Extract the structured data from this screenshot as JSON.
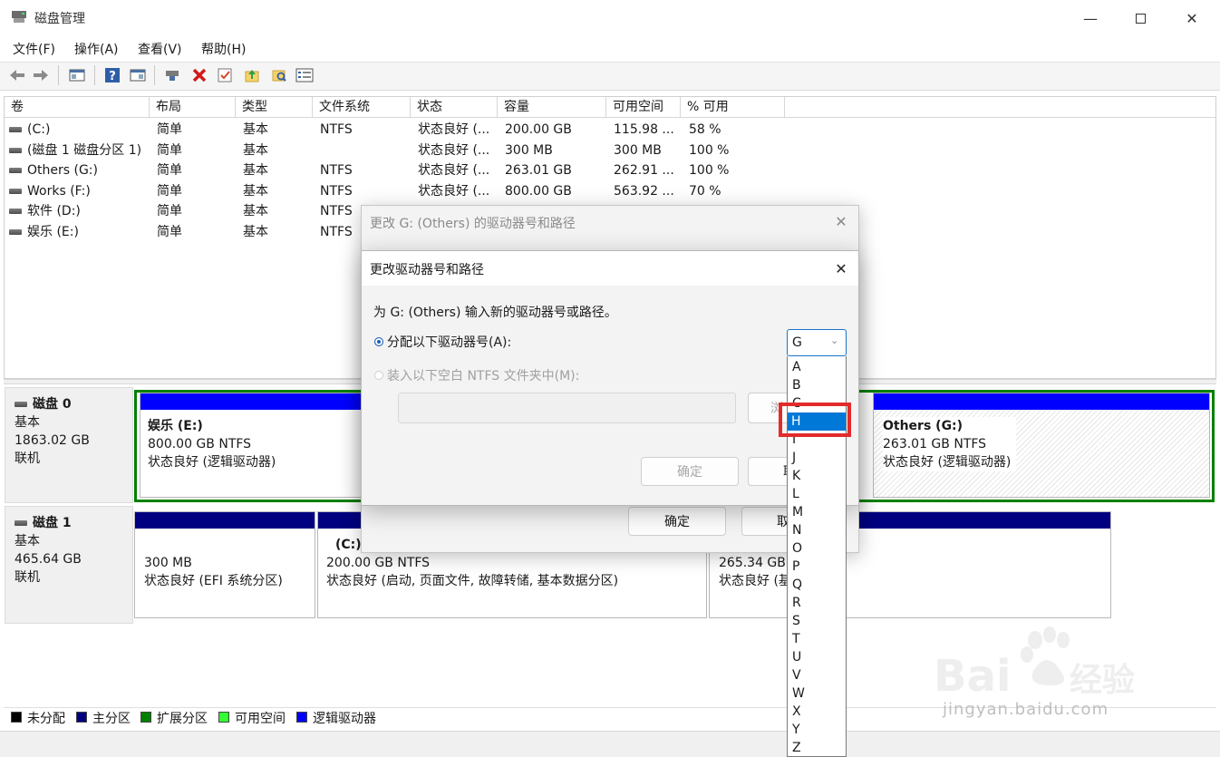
{
  "window": {
    "title": "磁盘管理",
    "menus": [
      "文件(F)",
      "操作(A)",
      "查看(V)",
      "帮助(H)"
    ]
  },
  "volume_table": {
    "headers": [
      "卷",
      "布局",
      "类型",
      "文件系统",
      "状态",
      "容量",
      "可用空间",
      "% 可用"
    ],
    "rows": [
      [
        "(C:)",
        "简单",
        "基本",
        "NTFS",
        "状态良好 (...",
        "200.00 GB",
        "115.98 ...",
        "58 %"
      ],
      [
        "(磁盘 1 磁盘分区 1)",
        "简单",
        "基本",
        "",
        "状态良好 (...",
        "300 MB",
        "300 MB",
        "100 %"
      ],
      [
        "Others (G:)",
        "简单",
        "基本",
        "NTFS",
        "状态良好 (...",
        "263.01 GB",
        "262.91 ...",
        "100 %"
      ],
      [
        "Works (F:)",
        "简单",
        "基本",
        "NTFS",
        "状态良好 (...",
        "800.00 GB",
        "563.92 ...",
        "70 %"
      ],
      [
        "软件 (D:)",
        "简单",
        "基本",
        "NTFS",
        "",
        "",
        "",
        ""
      ],
      [
        "娱乐 (E:)",
        "简单",
        "基本",
        "NTFS",
        "",
        "",
        "",
        ""
      ]
    ]
  },
  "disks": {
    "disk0": {
      "name": "磁盘 0",
      "type": "基本",
      "size": "1863.02 GB",
      "status": "联机",
      "p_entertain": {
        "name": "娱乐  (E:)",
        "size": "800.00 GB NTFS",
        "status": "状态良好 (逻辑驱动器)"
      },
      "p_others": {
        "name": "Others  (G:)",
        "size": "263.01 GB NTFS",
        "status": "状态良好 (逻辑驱动器)"
      }
    },
    "disk1": {
      "name": "磁盘 1",
      "type": "基本",
      "size": "465.64 GB",
      "status": "联机",
      "p_efi": {
        "size": "300 MB",
        "status": "状态良好 (EFI 系统分区)"
      },
      "p_c": {
        "name": "(C:)",
        "size": "200.00 GB NTFS",
        "status": "状态良好 (启动, 页面文件, 故障转储, 基本数据分区)"
      },
      "p_other": {
        "size": "265.34 GB",
        "status": "状态良好 (基"
      }
    }
  },
  "legend": [
    {
      "label": "未分配",
      "color": "#000000"
    },
    {
      "label": "主分区",
      "color": "#000080"
    },
    {
      "label": "扩展分区",
      "color": "#008000"
    },
    {
      "label": "可用空间",
      "color": "#33ff33"
    },
    {
      "label": "逻辑驱动器",
      "color": "#0000ff"
    }
  ],
  "dialog_back": {
    "title": "更改 G: (Others) 的驱动器号和路径",
    "ok": "确定",
    "cancel_partial": "取"
  },
  "dialog_front": {
    "title": "更改驱动器号和路径",
    "prompt": "为 G: (Others) 输入新的驱动器号或路径。",
    "assign_label": "分配以下驱动器号(A):",
    "mount_label": "装入以下空白 NTFS 文件夹中(M):",
    "browse_partial": "浏",
    "ok": "确定",
    "cancel_partial": "取",
    "selected_letter": "G",
    "letters": [
      "A",
      "B",
      "C",
      "H",
      "I",
      "J",
      "K",
      "L",
      "M",
      "N",
      "O",
      "P",
      "Q",
      "R",
      "S",
      "T",
      "U",
      "V",
      "W",
      "X",
      "Y",
      "Z"
    ],
    "highlighted": "H"
  },
  "watermark": {
    "text": "jingyan.baidu.com",
    "brand": "Bai",
    "brand2": "du",
    "brand3": "经验"
  },
  "colors": {
    "primary_partition": "#000080",
    "logical_drive": "#0000ff",
    "extended": "#008000",
    "highlight_box": "#e32b2b",
    "selection": "#0078d7"
  }
}
